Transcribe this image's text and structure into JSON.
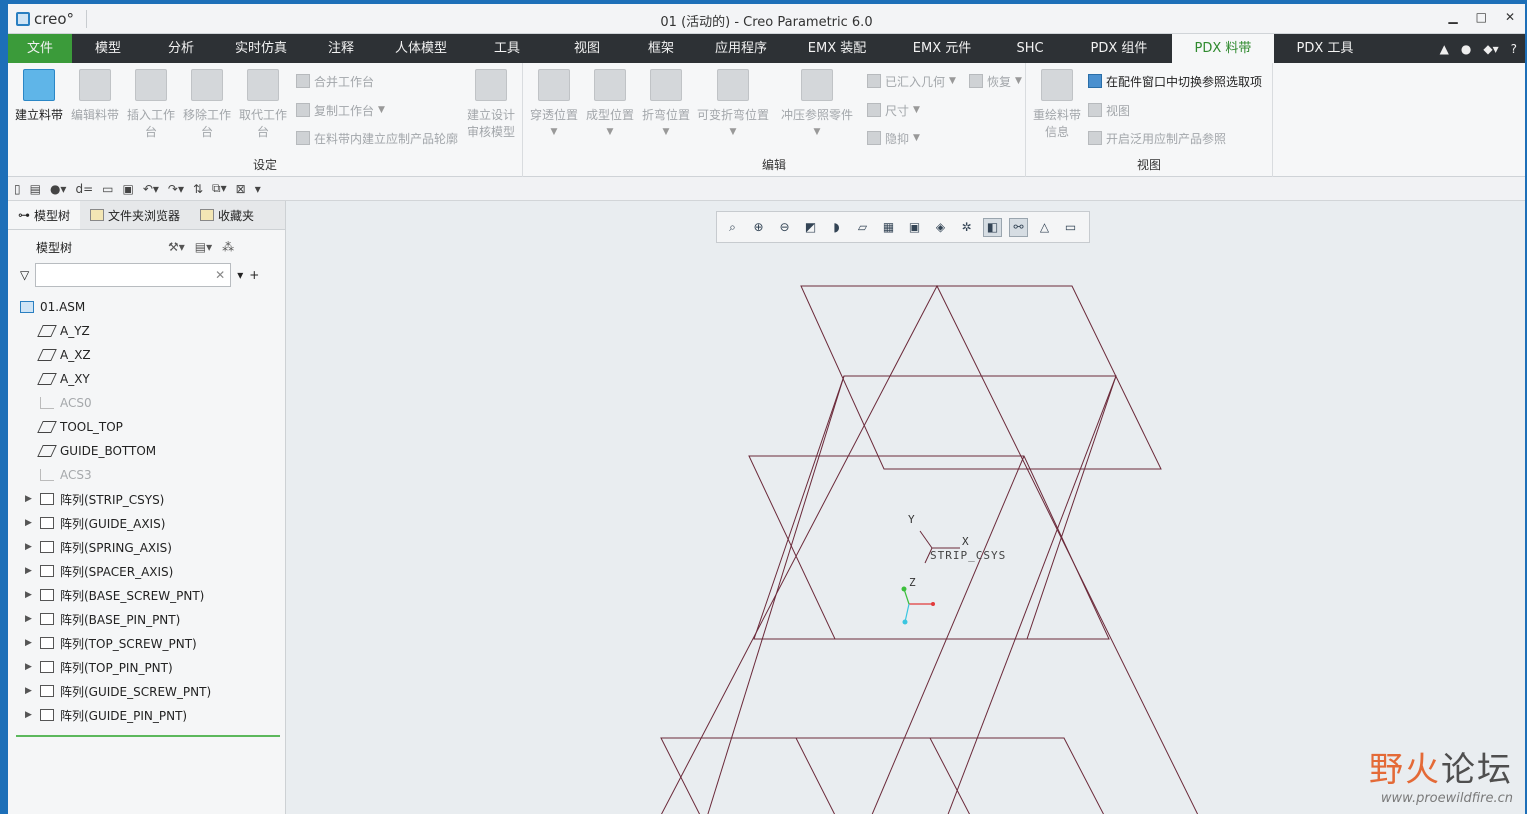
{
  "window": {
    "logo_text": "creo°",
    "title": "01 (活动的) - Creo Parametric 6.0",
    "minimize": "▁",
    "maximize": "□",
    "close": "✕"
  },
  "tabs": [
    {
      "label": "文件"
    },
    {
      "label": "模型"
    },
    {
      "label": "分析"
    },
    {
      "label": "实时仿真"
    },
    {
      "label": "注释"
    },
    {
      "label": "人体模型"
    },
    {
      "label": "工具"
    },
    {
      "label": "视图"
    },
    {
      "label": "框架"
    },
    {
      "label": "应用程序"
    },
    {
      "label": "EMX 装配"
    },
    {
      "label": "EMX 元件"
    },
    {
      "label": "SHC"
    },
    {
      "label": "PDX 组件"
    },
    {
      "label": "PDX 料带"
    },
    {
      "label": "PDX 工具"
    }
  ],
  "active_tab": "PDX 料带",
  "ribbon": {
    "setup": {
      "title": "设定",
      "create_strip": "建立料带",
      "edit_strip": "编辑料带",
      "insert_station": "插入工作台",
      "remove_station": "移除工作台",
      "replace_station": "取代工作台",
      "merge_station": "合并工作台",
      "copy_station": "复制工作台",
      "build_outline": "在料带内建立应制产品轮廓",
      "design_review": "建立设计审核模型"
    },
    "edit": {
      "title": "编辑",
      "pass_position": "穿透位置",
      "form_position": "成型位置",
      "bend_position": "折弯位置",
      "variable_bend": "可变折弯位置",
      "stamp_ref": "冲压参照零件",
      "imported_geom": "已汇入几何",
      "restore": "恢复",
      "dimension": "尺寸",
      "hide": "隐抑"
    },
    "view": {
      "title": "视图",
      "redraw_info": "重绘料带信息",
      "switch_ref": "在配件窗口中切换参照选取项",
      "view": "视图",
      "enable_ref": "开启泛用应制产品参照"
    }
  },
  "nav": {
    "tab_model_tree": "模型树",
    "tab_folder_browser": "文件夹浏览器",
    "tab_favorites": "收藏夹",
    "tree_title": "模型树",
    "filter_placeholder": "",
    "tree": [
      {
        "label": "01.ASM",
        "kind": "asm",
        "disabled": false,
        "expandable": false,
        "root": true
      },
      {
        "label": "A_YZ",
        "kind": "plane",
        "disabled": false,
        "expandable": false
      },
      {
        "label": "A_XZ",
        "kind": "plane",
        "disabled": false,
        "expandable": false
      },
      {
        "label": "A_XY",
        "kind": "plane",
        "disabled": false,
        "expandable": false
      },
      {
        "label": "ACS0",
        "kind": "csys",
        "disabled": true,
        "expandable": false
      },
      {
        "label": "TOOL_TOP",
        "kind": "plane",
        "disabled": false,
        "expandable": false
      },
      {
        "label": "GUIDE_BOTTOM",
        "kind": "plane",
        "disabled": false,
        "expandable": false
      },
      {
        "label": "ACS3",
        "kind": "csys",
        "disabled": true,
        "expandable": false
      },
      {
        "label": "阵列(STRIP_CSYS)",
        "kind": "pattern",
        "disabled": false,
        "expandable": true
      },
      {
        "label": "阵列(GUIDE_AXIS)",
        "kind": "pattern",
        "disabled": false,
        "expandable": true
      },
      {
        "label": "阵列(SPRING_AXIS)",
        "kind": "pattern",
        "disabled": false,
        "expandable": true
      },
      {
        "label": "阵列(SPACER_AXIS)",
        "kind": "pattern",
        "disabled": false,
        "expandable": true
      },
      {
        "label": "阵列(BASE_SCREW_PNT)",
        "kind": "pattern",
        "disabled": false,
        "expandable": true
      },
      {
        "label": "阵列(BASE_PIN_PNT)",
        "kind": "pattern",
        "disabled": false,
        "expandable": true
      },
      {
        "label": "阵列(TOP_SCREW_PNT)",
        "kind": "pattern",
        "disabled": false,
        "expandable": true
      },
      {
        "label": "阵列(TOP_PIN_PNT)",
        "kind": "pattern",
        "disabled": false,
        "expandable": true
      },
      {
        "label": "阵列(GUIDE_SCREW_PNT)",
        "kind": "pattern",
        "disabled": false,
        "expandable": true
      },
      {
        "label": "阵列(GUIDE_PIN_PNT)",
        "kind": "pattern",
        "disabled": false,
        "expandable": true
      }
    ]
  },
  "viewport": {
    "csys_label": "STRIP_CSYS",
    "axis_x": "X",
    "axis_y": "Y",
    "axis_z": "Z",
    "line_color": "#6b2a3a"
  },
  "watermark": {
    "title_part1": "野火",
    "title_part2": "论坛",
    "url": "www.proewildfire.cn"
  },
  "colors": {
    "file_tab": "#3b9b3a",
    "tabbar": "#2d3135",
    "accent": "#2f8a2e"
  }
}
